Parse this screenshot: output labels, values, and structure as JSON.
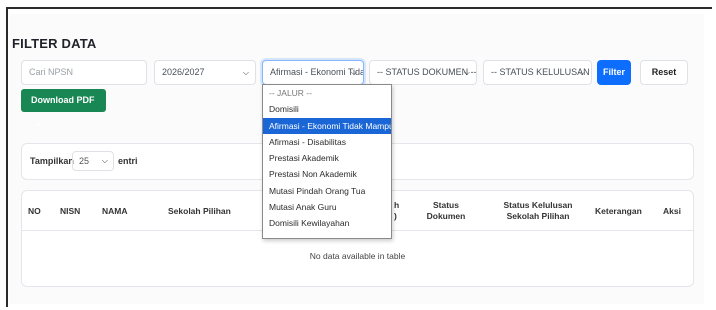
{
  "page": {
    "heading": "FILTER DATA"
  },
  "filters": {
    "npsn_placeholder": "Cari NPSN",
    "year": "2026/2027",
    "jalur": "Afirmasi - Ekonomi Tida",
    "status_dokumen": "-- STATUS DOKUMEN --",
    "status_kelulusan": "-- STATUS KELULUSAN --",
    "filter_label": "Filter",
    "reset_label": "Reset"
  },
  "download": {
    "label": "Download PDF"
  },
  "entries": {
    "show_label": "Tampilkan",
    "value": "25",
    "suffix": "entri"
  },
  "table": {
    "headers": {
      "no": "NO",
      "nisn": "NISN",
      "nama": "NAMA",
      "sekolah_pilihan": "Sekolah Pilihan",
      "hidden_partial_1": "h",
      "hidden_partial_2": ")",
      "status_dokumen": "Status Dokumen",
      "status_kelulusan": "Status Kelulusan Sekolah Pilihan",
      "keterangan": "Keterangan",
      "aksi": "Aksi"
    },
    "empty_text": "No data available in table"
  },
  "jalur_dropdown": {
    "options": [
      "-- JALUR --",
      "Domisili",
      "Afirmasi - Ekonomi Tidak Mampu",
      "Afirmasi - Disabilitas",
      "Prestasi Akademik",
      "Prestasi Non Akademik",
      "Mutasi Pindah Orang Tua",
      "Mutasi Anak Guru",
      "Domisili Kewilayahan"
    ],
    "selected_index": 2
  },
  "colors": {
    "primary": "#0d6efd",
    "success": "#198754",
    "selected_option": "#1a66d6"
  },
  "icons": {
    "chevron": "chevron-down-icon"
  }
}
